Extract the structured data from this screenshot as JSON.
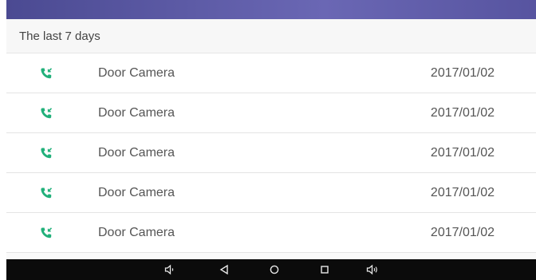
{
  "section": {
    "title": "The last 7 days"
  },
  "calls": [
    {
      "name": "Door Camera",
      "date": "2017/01/02",
      "icon": "incoming-call-icon"
    },
    {
      "name": "Door Camera",
      "date": "2017/01/02",
      "icon": "incoming-call-icon"
    },
    {
      "name": "Door Camera",
      "date": "2017/01/02",
      "icon": "incoming-call-icon"
    },
    {
      "name": "Door Camera",
      "date": "2017/01/02",
      "icon": "incoming-call-icon"
    },
    {
      "name": "Door Camera",
      "date": "2017/01/02",
      "icon": "incoming-call-icon"
    }
  ],
  "navigation_bar": {
    "buttons": [
      "volume-down-icon",
      "back-icon",
      "home-icon",
      "recents-icon",
      "volume-up-icon"
    ]
  },
  "colors": {
    "call_icon": "#21b07a",
    "header_band": "#5d5ba6",
    "navbar": "#0b0b0b"
  }
}
